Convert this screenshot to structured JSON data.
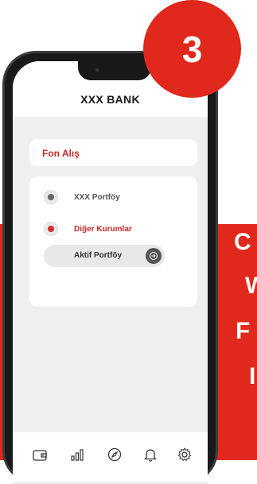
{
  "step_badge": "3",
  "side_text": [
    "C",
    "W",
    "F",
    "I"
  ],
  "app": {
    "title": "XXX BANK"
  },
  "page": {
    "section_title": "Fon Alış"
  },
  "options": [
    {
      "label": "XXX Portföy",
      "selected": false
    },
    {
      "label": "Diğer Kurumlar",
      "selected": true
    }
  ],
  "sub_option": {
    "label": "Aktif Portföy"
  },
  "tabbar": {
    "icons": [
      "wallet-icon",
      "bar-chart-icon",
      "compass-icon",
      "bell-icon",
      "gear-icon"
    ]
  },
  "colors": {
    "accent": "#e0281c",
    "accent_text": "#c62828",
    "screen_bg": "#efefef"
  }
}
